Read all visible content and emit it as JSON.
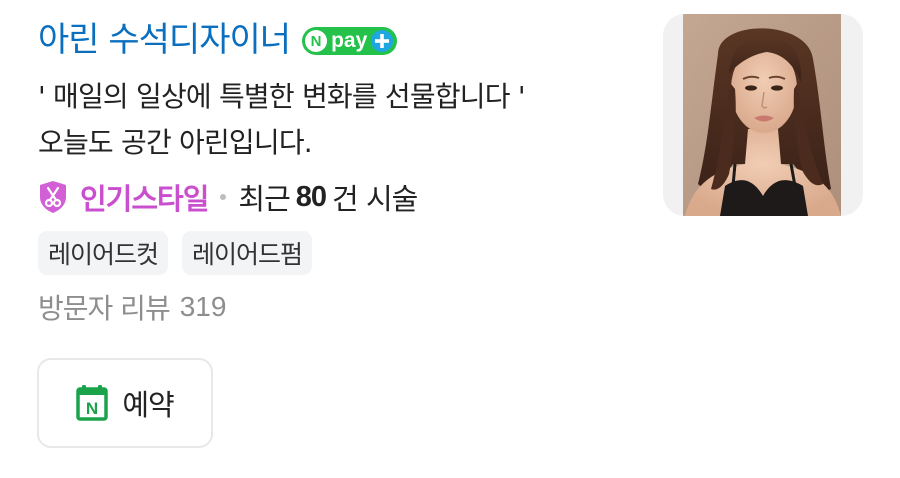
{
  "shop": {
    "name": "아린 수석디자이너",
    "name_color": "#0a6fbf"
  },
  "npay": {
    "n_letter": "N",
    "label": "pay",
    "bg_color": "#25c24b",
    "plus_color": "#1ea7e1"
  },
  "description": {
    "line1": "' 매일의 일상에 특별한 변화를 선물합니다 '",
    "line2": "오늘도 공간 아린입니다."
  },
  "popular": {
    "icon": "scissors-shield-icon",
    "label": "인기스타일",
    "color": "#c94fcf",
    "recent_prefix": "최근",
    "recent_count": "80",
    "recent_suffix": "건 시술"
  },
  "tags": [
    {
      "label": "레이어드컷"
    },
    {
      "label": "레이어드펌"
    }
  ],
  "reviews": {
    "label": "방문자 리뷰",
    "count": "319"
  },
  "reserve": {
    "icon": "naver-calendar-icon",
    "icon_letter": "N",
    "icon_color": "#1aa34a",
    "label": "예약"
  },
  "thumbnail": {
    "subject": "portrait-photo"
  }
}
